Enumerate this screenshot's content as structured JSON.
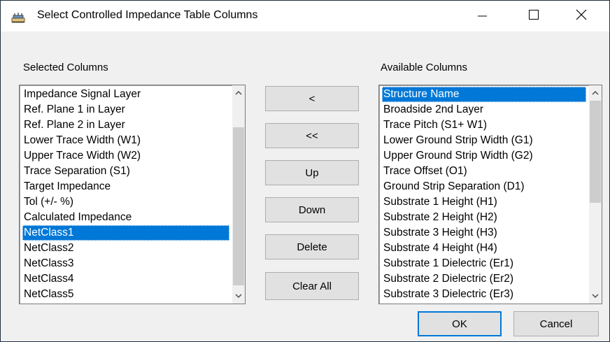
{
  "window": {
    "title": "Select Controlled Impedance Table Columns",
    "icons": {
      "app": "pcb-app-icon",
      "minimize": "minimize-icon",
      "maximize": "maximize-icon",
      "close": "close-icon"
    }
  },
  "selected": {
    "label": "Selected Columns",
    "items": [
      "Impedance Signal Layer",
      "Ref. Plane 1 in Layer",
      "Ref. Plane 2 in Layer",
      "Lower Trace Width (W1)",
      "Upper Trace Width (W2)",
      "Trace Separation (S1)",
      "Target Impedance",
      "Tol (+/- %)",
      "Calculated Impedance",
      "NetClass1",
      "NetClass2",
      "NetClass3",
      "NetClass4",
      "NetClass5"
    ],
    "selected_item": "NetClass1"
  },
  "available": {
    "label": "Available Columns",
    "items": [
      "Structure Name",
      "Broadside 2nd Layer",
      "Trace Pitch (S1+ W1)",
      "Lower Ground Strip Width (G1)",
      "Upper Ground Strip Width (G2)",
      "Trace Offset (O1)",
      "Ground Strip Separation (D1)",
      "Substrate 1 Height (H1)",
      "Substrate 2 Height (H2)",
      "Substrate 3 Height (H3)",
      "Substrate 4 Height (H4)",
      "Substrate 1 Dielectric (Er1)",
      "Substrate 2 Dielectric (Er2)",
      "Substrate 3 Dielectric (Er3)"
    ],
    "selected_item": "Structure Name"
  },
  "buttons": {
    "move_one": "<",
    "move_all": "<<",
    "up": "Up",
    "down": "Down",
    "delete": "Delete",
    "clear_all": "Clear All",
    "ok": "OK",
    "cancel": "Cancel"
  },
  "colors": {
    "selection": "#0078d7",
    "dialog_bg": "#f0f0f0",
    "button_bg": "#e1e1e1"
  }
}
